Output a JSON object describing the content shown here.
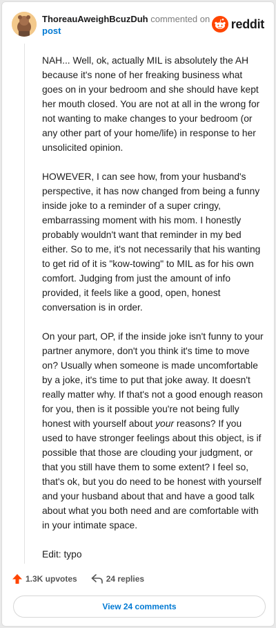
{
  "comment": {
    "username": "ThoreauAweighBcuzDuh",
    "action": "commented on",
    "target": "post",
    "paragraphs": [
      "NAH... Well, ok, actually MIL is absolutely the AH because it's none of her freaking business what goes on in your bedroom and she should have kept her mouth closed. You are not at all in the wrong for not wanting to make changes to your bedroom (or any other part of your home/life) in response to her unsolicited opinion.",
      "HOWEVER, I can see how, from your husband's perspective, it has now changed from being a funny inside joke to a reminder of a super cringy, embarrassing moment with his mom. I honestly probably wouldn't want that reminder in my bed either. So to me, it's not necessarily that his wanting to get rid of it is \"kow-towing\" to MIL as for his own comfort. Judging from just the amount of info provided, it feels like a good, open, honest conversation is in order."
    ],
    "p3_before": "On your part, OP, if the inside joke isn't funny to your partner anymore, don't you think it's time to move on? Usually when someone is made uncomfortable by a joke, it's time to put that joke away. It doesn't really matter why. If that's not a good enough reason for you, then is it possible you're not being fully honest with yourself about ",
    "p3_em": "your",
    "p3_after": " reasons? If you used to have stronger feelings about this object, is if possible that those are clouding your judgment, or that you still have them to some extent? I feel so, that's ok, but you do need to be honest with yourself and your husband about that and have a good talk about what you both need and are comfortable with in your intimate space.",
    "edit": "Edit: typo"
  },
  "brand": {
    "name": "reddit",
    "color": "#ff4500"
  },
  "footer": {
    "upvotes": "1.3K upvotes",
    "replies": "24 replies",
    "upvote_color": "#ff4500"
  },
  "view_comments": "View 24 comments"
}
